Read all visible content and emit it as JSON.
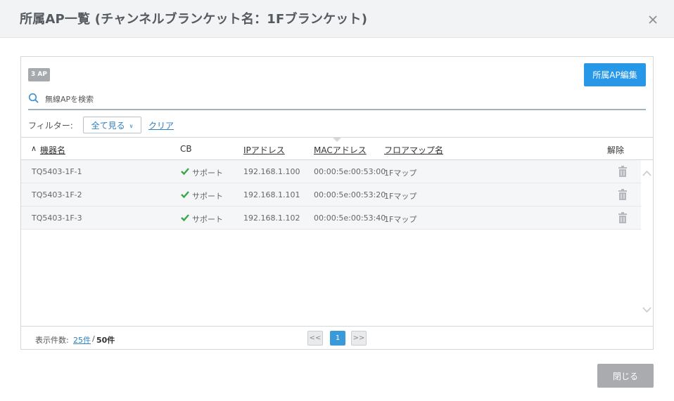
{
  "dialog": {
    "title": "所属AP一覧 (チャンネルブランケット名：1Fブランケット)",
    "close_button_label": "閉じる"
  },
  "toolbar": {
    "ap_count_badge": "3 AP",
    "edit_button_label": "所属AP編集"
  },
  "search": {
    "placeholder": "無線APを検索",
    "value": ""
  },
  "filter": {
    "label": "フィルター:",
    "selected": "全て見る",
    "clear_label": "クリア"
  },
  "table": {
    "columns": {
      "name": "機器名",
      "cb": "CB",
      "ip": "IPアドレス",
      "mac": "MACアドレス",
      "floor": "フロアマップ名",
      "remove": "解除"
    },
    "rows": [
      {
        "name": "TQ5403-1F-1",
        "cb": "サポート",
        "ip": "192.168.1.100",
        "mac": "00:00:5e:00:53:00",
        "floor": "1Fマップ"
      },
      {
        "name": "TQ5403-1F-2",
        "cb": "サポート",
        "ip": "192.168.1.101",
        "mac": "00:00:5e:00:53:20",
        "floor": "1Fマップ"
      },
      {
        "name": "TQ5403-1F-3",
        "cb": "サポート",
        "ip": "192.168.1.102",
        "mac": "00:00:5e:00:53:40",
        "floor": "1Fマップ"
      }
    ]
  },
  "footer": {
    "per_page_label": "表示件数:",
    "per_page_value": "25件",
    "separator": "/",
    "total": "50件"
  },
  "pagination": {
    "prev": "<<",
    "current": "1",
    "next": ">>"
  },
  "colors": {
    "accent": "#2797e8",
    "check": "#3aa64a",
    "link": "#2f7fbf"
  },
  "icons": [
    "close-icon",
    "search-icon",
    "chevron-down-icon",
    "check-icon",
    "trash-icon",
    "scroll-up-icon",
    "scroll-down-icon",
    "sort-asc-icon"
  ]
}
